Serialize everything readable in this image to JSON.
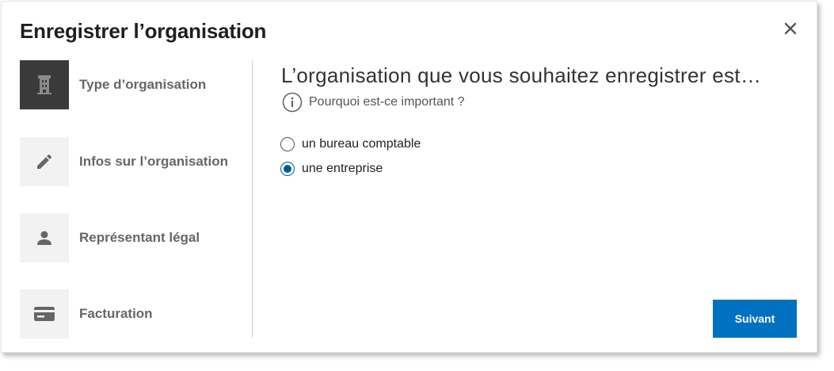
{
  "dialog": {
    "title": "Enregistrer l’organisation",
    "close_icon": "close-icon"
  },
  "steps": [
    {
      "label": "Type d’organisation",
      "icon": "building-icon",
      "active": true
    },
    {
      "label": "Infos sur l’organisation",
      "icon": "pencil-icon",
      "active": false
    },
    {
      "label": "Représentant légal",
      "icon": "person-icon",
      "active": false
    },
    {
      "label": "Facturation",
      "icon": "credit-card-icon",
      "active": false
    }
  ],
  "main": {
    "question": "L’organisation que vous souhaitez enregistrer est…",
    "why_link": "Pourquoi est-ce important ?",
    "options": [
      {
        "label": "un bureau comptable",
        "checked": false
      },
      {
        "label": "une entreprise",
        "checked": true
      }
    ],
    "next_label": "Suivant"
  },
  "colors": {
    "primary": "#0070c0",
    "radio_selected": "#005b9a",
    "active_step": "#3a3a3a"
  }
}
